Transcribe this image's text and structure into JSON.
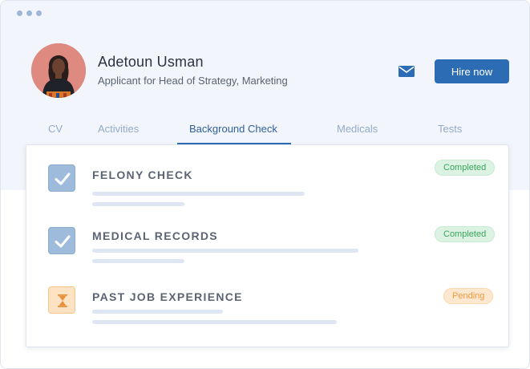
{
  "window": {
    "controls": [
      "dot",
      "dot",
      "dot"
    ]
  },
  "profile": {
    "name": "Adetoun Usman",
    "role": "Applicant for Head of Strategy, Marketing",
    "avatar_icon": "applicant-photo"
  },
  "actions": {
    "mail_icon": "envelope-icon",
    "hire_label": "Hire now"
  },
  "tabs": [
    {
      "label": "CV",
      "active": false
    },
    {
      "label": "Activities",
      "active": false
    },
    {
      "label": "Background Check",
      "active": true
    },
    {
      "label": "Medicals",
      "active": false
    },
    {
      "label": "Tests",
      "active": false
    }
  ],
  "checks": [
    {
      "title": "FELONY CHECK",
      "status": "Completed",
      "icon": "checkmark-icon"
    },
    {
      "title": "MEDICAL RECORDS",
      "status": "Completed",
      "icon": "checkmark-icon"
    },
    {
      "title": "PAST JOB EXPERIENCE",
      "status": "Pending",
      "icon": "hourglass-icon"
    }
  ],
  "colors": {
    "accent": "#2b6cb5",
    "completed": "#3aa55c",
    "pending": "#ef9a3e",
    "header_bg": "#f2f5fb"
  }
}
